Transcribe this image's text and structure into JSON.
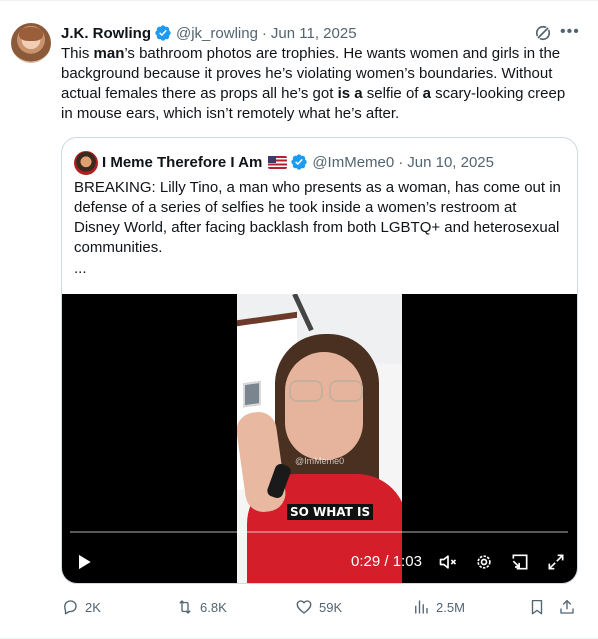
{
  "author": {
    "name": "J.K. Rowling",
    "handle": "@jk_rowling",
    "separator": "·",
    "date": "Jun 11, 2025"
  },
  "post": {
    "segments": [
      {
        "text": "This ",
        "bold": false
      },
      {
        "text": "man",
        "bold": true
      },
      {
        "text": "’s bathroom photos are trophies. He wants women and girls in the background because it proves he’s violating women’s boundaries. Without actual females there as props all he’s got ",
        "bold": false
      },
      {
        "text": "is a",
        "bold": true
      },
      {
        "text": " selfie of ",
        "bold": false
      },
      {
        "text": "a",
        "bold": true
      },
      {
        "text": " scary-looking creep in mouse ears, which isn’t remotely what he’s after.",
        "bold": false
      }
    ]
  },
  "quote": {
    "name": "I Meme Therefore I Am",
    "handle": "@ImMeme0",
    "separator": "·",
    "date": "Jun 10, 2025",
    "text": "BREAKING: Lilly Tino, a man who presents as a woman, has come out in defense of a series of selfies he took inside a women’s restroom at Disney World, after facing backlash from both LGBTQ+ and heterosexual communities.",
    "ellipsis": "...",
    "video": {
      "watermark": "@ImMeme0",
      "caption": "SO WHAT IS",
      "current_time": "0:29",
      "time_separator": " / ",
      "duration": "1:03",
      "progress": 0
    }
  },
  "actions": {
    "replies": "2K",
    "reposts": "6.8K",
    "likes": "59K",
    "views": "2.5M"
  },
  "icons": {
    "verified": "verified-badge-icon",
    "grok": "grok-icon",
    "more": "more-icon",
    "play": "play-icon",
    "mute": "mute-icon",
    "settings": "gear-icon",
    "pip": "picture-in-picture-icon",
    "fullscreen": "fullscreen-icon",
    "reply": "reply-icon",
    "repost": "repost-icon",
    "like": "heart-icon",
    "views": "views-icon",
    "bookmark": "bookmark-icon",
    "share": "share-icon"
  },
  "colors": {
    "verified": "#1d9bf0",
    "text": "#0f1419",
    "muted": "#536471",
    "border": "#cfd9de"
  }
}
